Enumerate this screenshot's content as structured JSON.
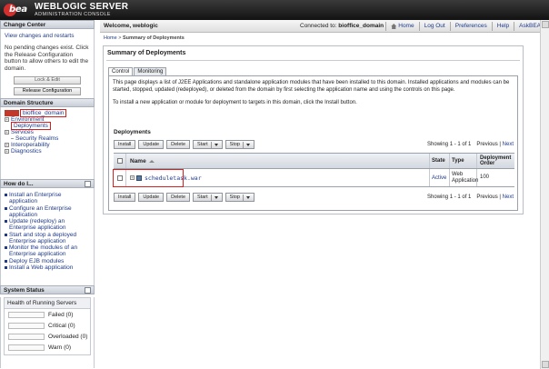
{
  "header": {
    "logo": "bea",
    "product_title": "WEBLOGIC SERVER",
    "product_subtitle": "ADMINISTRATION CONSOLE"
  },
  "topbar": {
    "welcome": "Welcome, weblogic",
    "connected_prefix": "Connected to:",
    "domain": "bioffice_domain",
    "links": [
      "Home",
      "Log Out",
      "Preferences",
      "Help",
      "AskBEA"
    ]
  },
  "change_center": {
    "title": "Change Center",
    "view_link": "View changes and restarts",
    "message": "No pending changes exist. Click the Release Configuration button to allow others to edit the domain.",
    "lock_button": "Lock & Edit",
    "release_button": "Release Configuration"
  },
  "domain_structure": {
    "title": "Domain Structure",
    "root": "bioffice_domain",
    "items": [
      "Environment",
      "Deployments",
      "Services",
      "Security Realms",
      "Interoperability",
      "Diagnostics"
    ]
  },
  "how_do_i": {
    "title": "How do I...",
    "items": [
      "Install an Enterprise application",
      "Configure an Enterprise application",
      "Update (redeploy) an Enterprise application",
      "Start and stop a deployed Enterprise application",
      "Monitor the modules of an Enterprise application",
      "Deploy EJB modules",
      "Install a Web application"
    ]
  },
  "system_status": {
    "title": "System Status",
    "health_title": "Health of Running Servers",
    "rows": [
      "Failed (0)",
      "Critical (0)",
      "Overloaded (0)",
      "Warn (0)"
    ]
  },
  "breadcrumb": {
    "home": "Home",
    "sep": " > ",
    "current": "Summary of Deployments"
  },
  "main": {
    "title": "Summary of Deployments",
    "tabs": [
      "Control",
      "Monitoring"
    ],
    "description": "This page displays a list of J2EE Applications and standalone application modules that have been installed to this domain. Installed applications and modules can be started, stopped, updated (redeployed), or deleted from the domain by first selecting the application name and using the controls on this page.",
    "install_hint": "To install a new application or module for deployment to targets in this domain, click the Install button.",
    "deployments_title": "Deployments",
    "buttons": {
      "install": "Install",
      "update": "Update",
      "delete": "Delete",
      "start": "Start",
      "stop": "Stop"
    },
    "paging": {
      "showing": "Showing 1 - 1 of 1",
      "previous": "Previous",
      "next": "Next"
    },
    "columns": {
      "name": "Name",
      "state": "State",
      "type": "Type",
      "order": "Deployment Order"
    },
    "rows": [
      {
        "name": "scheduletask.war",
        "state": "Active",
        "type": "Web Application",
        "order": "100"
      }
    ]
  },
  "colors": {
    "header_bg": "#1a1a1a",
    "link": "#1f3b8a",
    "highlight": "#d62020",
    "logo_red": "#d32f2f"
  }
}
